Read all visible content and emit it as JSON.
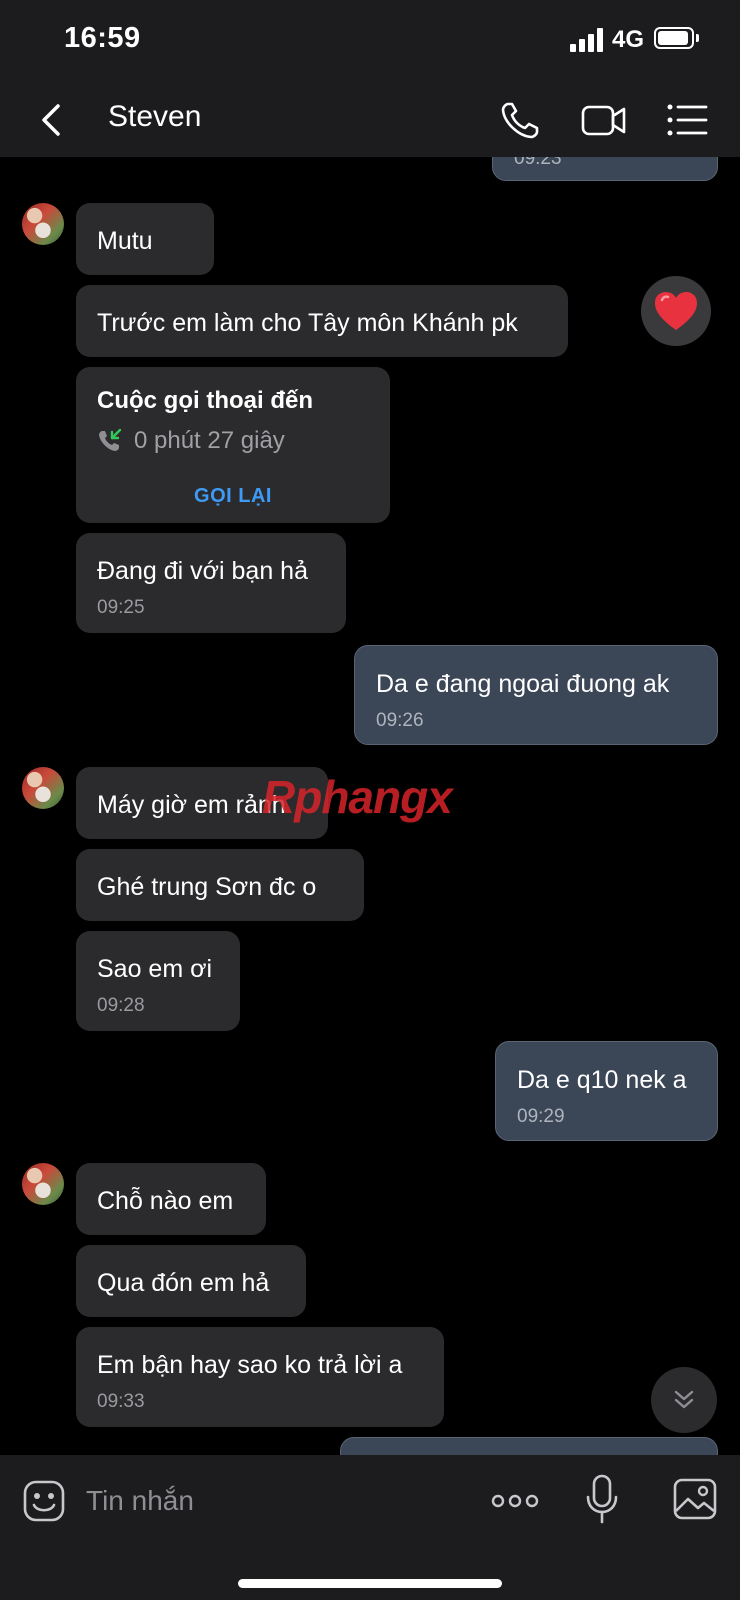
{
  "status_bar": {
    "time": "16:59",
    "network": "4G"
  },
  "header": {
    "contact_name": "Steven"
  },
  "top_partial_bubble": {
    "time": "09:23"
  },
  "messages": {
    "m1": {
      "text": "Mutu"
    },
    "m2": {
      "text": "Trước em làm cho Tây môn Khánh pk",
      "reaction": "❤"
    },
    "call": {
      "title": "Cuộc gọi thoại đến",
      "duration": "0 phút 27 giây",
      "action": "GỌI LẠI"
    },
    "m3": {
      "text": "Đang đi với bạn hả",
      "time": "09:25"
    },
    "m4": {
      "text": "Da e đang ngoai đuong ak",
      "time": "09:26"
    },
    "m5": {
      "text": "Máy giờ em rảnh"
    },
    "m6": {
      "text": "Ghé trung Sơn đc o"
    },
    "m7": {
      "text": "Sao em ơi",
      "time": "09:28"
    },
    "m8": {
      "text": "Da e q10 nek a",
      "time": "09:29"
    },
    "m9": {
      "text": "Chỗ nào em"
    },
    "m10": {
      "text": "Qua đón em hả"
    },
    "m11": {
      "text": "Em bận hay sao ko trả lời a",
      "time": "09:33"
    }
  },
  "watermark": {
    "part1": "Rphang",
    "part2": "x"
  },
  "input": {
    "placeholder": "Tin nhắn"
  },
  "colors": {
    "accent": "#3d9bf5",
    "my_bubble": "#3b4656",
    "their_bubble": "#2b2b2d",
    "background": "#000000"
  }
}
